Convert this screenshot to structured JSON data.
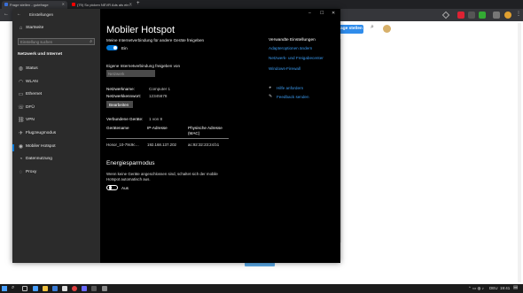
{
  "browser": {
    "tabs": [
      {
        "title": "Frage stellen - gutefrage",
        "favicon_color": "#3a6fd8"
      },
      {
        "title": "(79) So picken NEVR Ads als ein…",
        "favicon_color": "#ff0000"
      }
    ],
    "new_tab_label": "+",
    "page_button_label": "age stellen",
    "search_icon": "search-icon",
    "avatar_icon": "avatar"
  },
  "window": {
    "app_title": "Einstellungen",
    "controls": {
      "minimize": "–",
      "maximize": "☐",
      "close": "✕"
    }
  },
  "sidebar": {
    "home_label": "Startseite",
    "search_placeholder": "Einstellung suchen",
    "section_title": "Netzwerk und Internet",
    "items": [
      {
        "label": "Status",
        "icon": "globe-icon"
      },
      {
        "label": "WLAN",
        "icon": "wifi-icon"
      },
      {
        "label": "Ethernet",
        "icon": "ethernet-icon"
      },
      {
        "label": "DFÜ",
        "icon": "dialup-icon"
      },
      {
        "label": "VPN",
        "icon": "vpn-icon"
      },
      {
        "label": "Flugzeugmodus",
        "icon": "airplane-icon"
      },
      {
        "label": "Mobiler Hotspot",
        "icon": "hotspot-icon"
      },
      {
        "label": "Datennutzung",
        "icon": "data-usage-icon"
      },
      {
        "label": "Proxy",
        "icon": "proxy-icon"
      }
    ],
    "selected_index": 6
  },
  "main": {
    "title": "Mobiler Hotspot",
    "share_label": "Meine Internetverbindung für andere Geräte freigeben",
    "share_toggle_state": "Ein",
    "share_from_label": "Eigene Internetverbindung freigeben von",
    "share_from_value": "Netzwerk",
    "network_name_label": "Netzwerkname:",
    "network_name_value": "Computer 1",
    "network_password_label": "Netzwerkkennwort:",
    "network_password_value": "12345678",
    "edit_button": "Bearbeiten",
    "connected_label": "Verbundene Geräte:",
    "connected_value": "1 von 8",
    "table": {
      "headers": [
        "Gerätename",
        "IP-Adresse",
        "Physische Adresse (MAC)"
      ],
      "rows": [
        [
          "Honor_10-79c9c…",
          "192.168.137.202",
          "ac:92:32:23:24:b1"
        ]
      ]
    },
    "power_title": "Energiesparmodus",
    "power_desc": "Wenn keine Geräte angeschlossen sind, schaltet sich der mobile Hotspot automatisch aus.",
    "power_toggle_state": "Aus"
  },
  "related": {
    "title": "Verwandte Einstellungen",
    "links": [
      "Adapteroptionen ändern",
      "Netzwerk- und Freigabecenter",
      "Windows-Firewall"
    ],
    "help_label": "Hilfe anfordern",
    "feedback_label": "Feedback senden"
  },
  "taskbar": {
    "lang": "DEU",
    "time": "19:41"
  },
  "colors": {
    "accent": "#0078d7",
    "link": "#3b9cf2",
    "sidebar_bg": "#2b2b2b",
    "main_bg": "#000000"
  }
}
